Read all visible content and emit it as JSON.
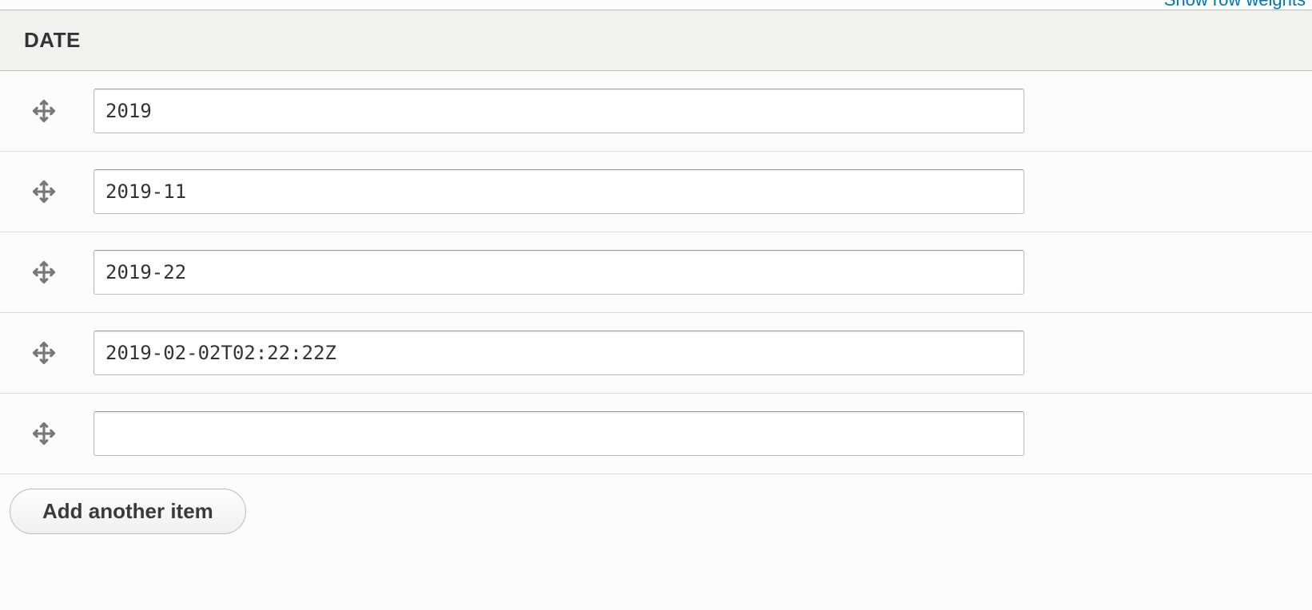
{
  "top_link": "Show row weights",
  "header": {
    "date_label": "DATE"
  },
  "rows": [
    {
      "value": "2019"
    },
    {
      "value": "2019-11"
    },
    {
      "value": "2019-22"
    },
    {
      "value": "2019-02-02T02:22:22Z"
    },
    {
      "value": ""
    }
  ],
  "add_button_label": "Add another item"
}
